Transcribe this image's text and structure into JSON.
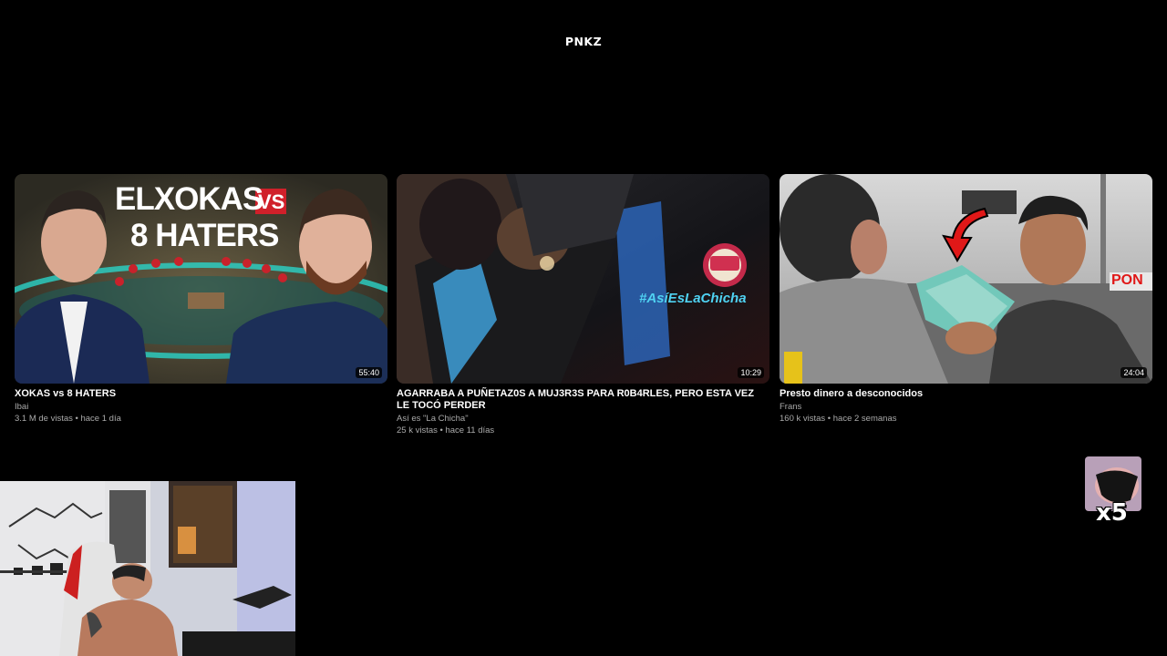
{
  "brand": {
    "logo": "PNKZ"
  },
  "videos": [
    {
      "title": "XOKAS vs 8 HATERS",
      "channel": "Ibai",
      "stats": "3.1 M de vistas • hace 1 día",
      "duration": "55:40",
      "thumb_text": [
        "ELXOKAS",
        "VS",
        "8 HATERS"
      ]
    },
    {
      "title": "AGARRABA A PUÑETAZ0S A MUJ3R3S PARA R0B4RLES, PERO ESTA VEZ LE TOCÓ PERDER",
      "channel": "Así es \"La Chicha\"",
      "stats": "25 k vistas • hace 11 días",
      "duration": "10:29",
      "thumb_text": [
        "#AsíEsLaChicha"
      ]
    },
    {
      "title": "Presto dinero a desconocidos",
      "channel": "Frans",
      "stats": "160 k vistas • hace 2 semanas",
      "duration": "24:04",
      "thumb_text": [
        "PON"
      ]
    }
  ],
  "overlay": {
    "multiplier": "x5"
  },
  "colors": {
    "background": "#000000",
    "accent_red": "#d0202a",
    "teal": "#2ad3c8"
  }
}
